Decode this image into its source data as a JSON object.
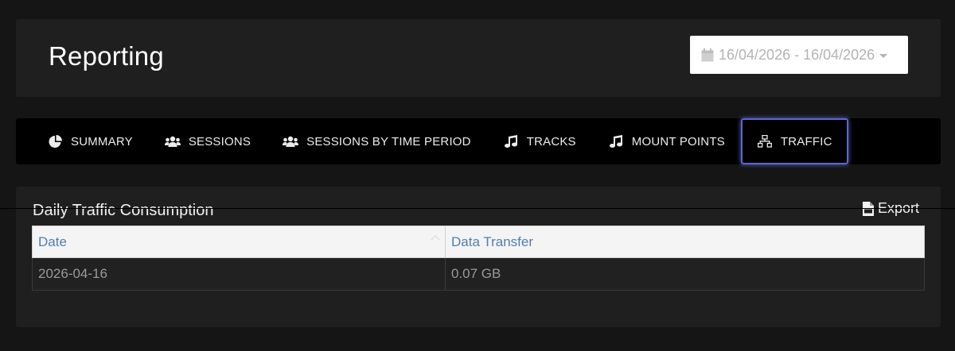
{
  "header": {
    "title": "Reporting",
    "date_range": "16/04/2026 - 16/04/2026"
  },
  "tabs": [
    {
      "label": "SUMMARY",
      "icon": "pie-chart-icon"
    },
    {
      "label": "SESSIONS",
      "icon": "users-icon"
    },
    {
      "label": "SESSIONS BY TIME PERIOD",
      "icon": "users-icon"
    },
    {
      "label": "TRACKS",
      "icon": "music-icon"
    },
    {
      "label": "MOUNT POINTS",
      "icon": "music-icon"
    },
    {
      "label": "TRAFFIC",
      "icon": "sitemap-icon",
      "active": true
    }
  ],
  "section": {
    "title": "Daily Traffic Consumption",
    "export_label": "Export"
  },
  "table": {
    "columns": [
      "Date",
      "Data Transfer"
    ],
    "rows": [
      [
        "2026-04-16",
        "0.07 GB"
      ]
    ]
  },
  "colors": {
    "background": "#151515",
    "panel": "#1f1f1f",
    "tab_bar": "#000000",
    "active_tab_border": "#5d66c9",
    "table_header_text": "#4f7fb0"
  }
}
